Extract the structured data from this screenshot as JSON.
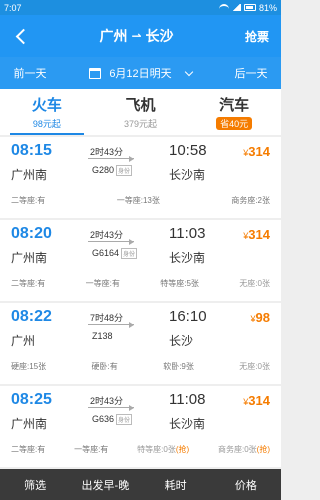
{
  "status": {
    "time": "7:07",
    "battery": "81%"
  },
  "header": {
    "from": "广州",
    "arrow": "⇀",
    "to": "长沙",
    "refund": "抢票"
  },
  "datebar": {
    "prev": "前一天",
    "date": "6月12日明天",
    "next": "后一天"
  },
  "tabs": [
    {
      "label": "火车",
      "sub": "98元起"
    },
    {
      "label": "飞机",
      "sub": "379元起"
    },
    {
      "label": "汽车",
      "badge": "省40元"
    }
  ],
  "trains": [
    {
      "dep_time": "08:15",
      "dep_station": "广州南",
      "arr_time": "10:58",
      "arr_station": "长沙南",
      "duration": "2时43分",
      "number": "G280",
      "id_tag": "身份",
      "yen": "¥",
      "price": "314",
      "seats": [
        "二等座:有",
        "一等座:13张",
        "商务座:2张"
      ]
    },
    {
      "dep_time": "08:20",
      "dep_station": "广州南",
      "arr_time": "11:03",
      "arr_station": "长沙南",
      "duration": "2时43分",
      "number": "G6164",
      "id_tag": "身份",
      "yen": "¥",
      "price": "314",
      "seats": [
        "二等座:有",
        "一等座:有",
        "特等座:5张",
        "无座:0张"
      ]
    },
    {
      "dep_time": "08:22",
      "dep_station": "广州",
      "arr_time": "16:10",
      "arr_station": "长沙",
      "duration": "7时48分",
      "number": "Z138",
      "id_tag": "",
      "yen": "¥",
      "price": "98",
      "seats": [
        "硬座:15张",
        "硬卧:有",
        "软卧:9张",
        "无座:0张"
      ]
    },
    {
      "dep_time": "08:25",
      "dep_station": "广州南",
      "arr_time": "11:08",
      "arr_station": "长沙南",
      "duration": "2时43分",
      "number": "G636",
      "id_tag": "身份",
      "yen": "¥",
      "price": "314",
      "seats": [
        "二等座:有",
        "一等座:有",
        "特等座:0张",
        "(抢)",
        "商务座:0张",
        "(抢)"
      ]
    }
  ],
  "bottom": {
    "filter": "筛选",
    "departure": "出发早-晚",
    "duration": "耗时",
    "price": "价格"
  }
}
